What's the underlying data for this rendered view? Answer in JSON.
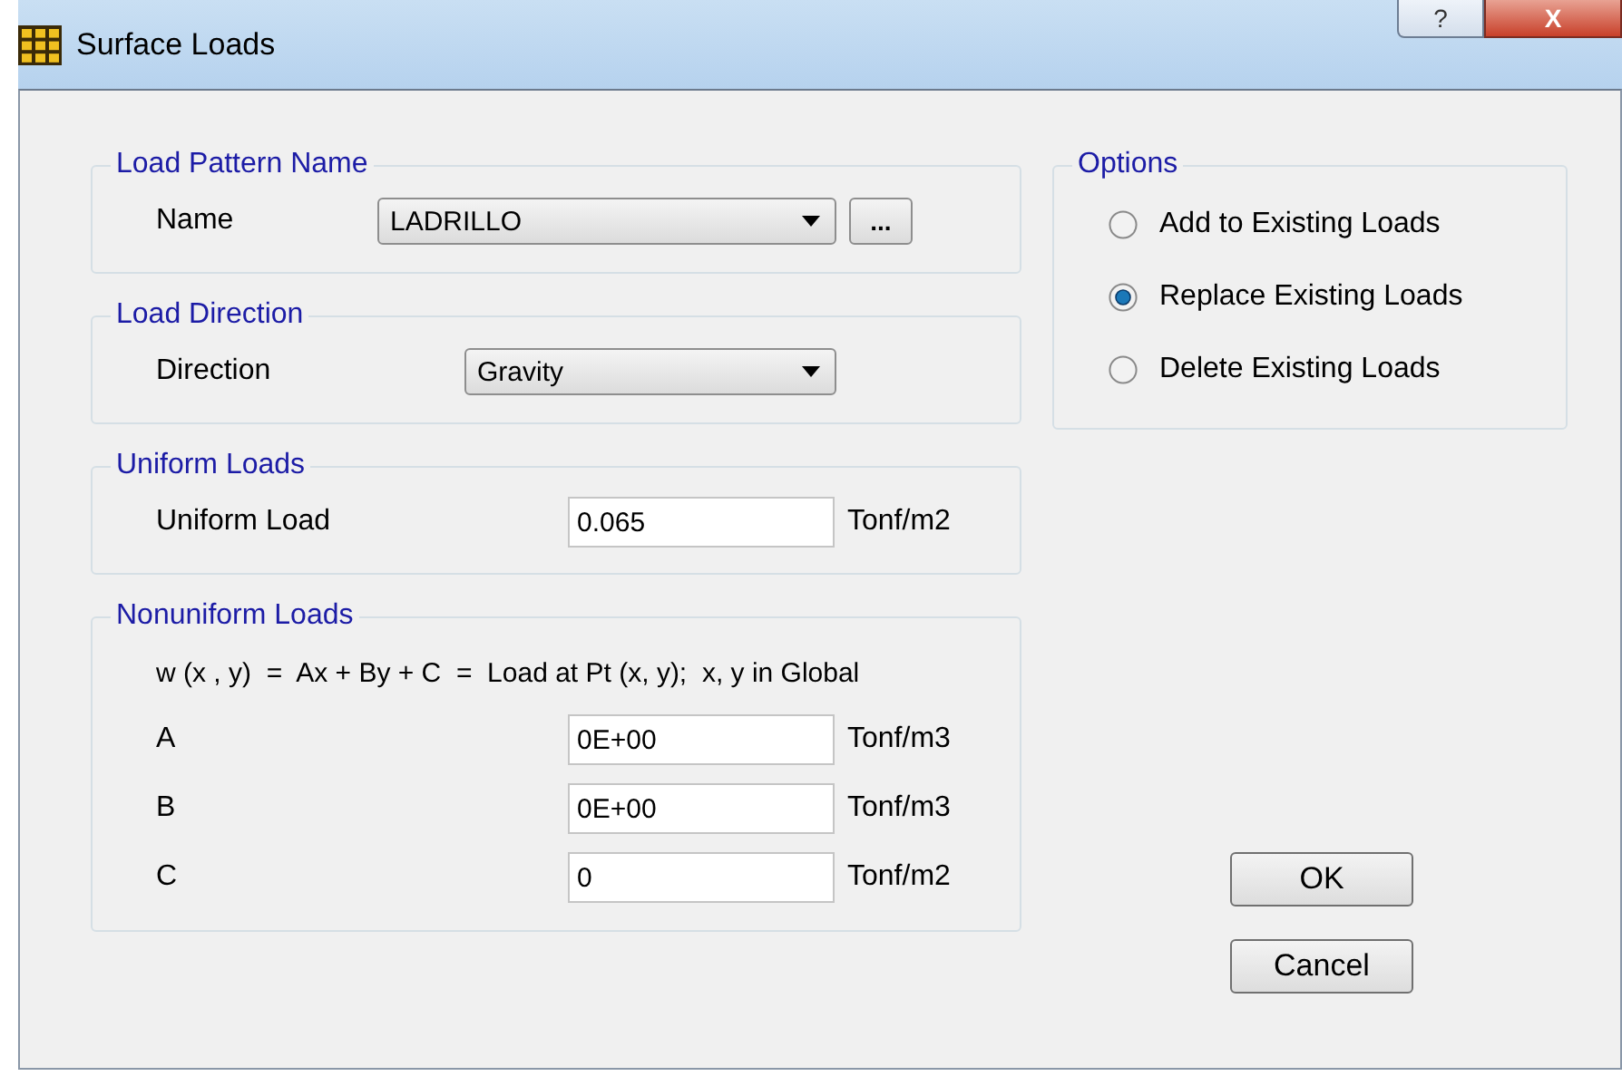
{
  "window": {
    "title": "Surface Loads",
    "help_button": "?",
    "close_button": "X"
  },
  "load_pattern_name": {
    "title": "Load Pattern Name",
    "label": "Name",
    "value": "LADRILLO",
    "browse_button": "..."
  },
  "load_direction": {
    "title": "Load Direction",
    "label": "Direction",
    "value": "Gravity"
  },
  "uniform_loads": {
    "title": "Uniform Loads",
    "label": "Uniform Load",
    "value": "0.065",
    "unit": "Tonf/m2"
  },
  "nonuniform_loads": {
    "title": "Nonuniform Loads",
    "formula": "w (x , y)  =  Ax + By + C  =  Load at Pt (x, y);  x, y in Global",
    "fields": [
      {
        "label": "A",
        "value": "0E+00",
        "unit": "Tonf/m3"
      },
      {
        "label": "B",
        "value": "0E+00",
        "unit": "Tonf/m3"
      },
      {
        "label": "C",
        "value": "0",
        "unit": "Tonf/m2"
      }
    ]
  },
  "options": {
    "title": "Options",
    "choices": [
      {
        "label": "Add to Existing Loads",
        "selected": false
      },
      {
        "label": "Replace Existing Loads",
        "selected": true
      },
      {
        "label": "Delete Existing Loads",
        "selected": false
      }
    ]
  },
  "buttons": [
    "OK",
    "Cancel"
  ]
}
